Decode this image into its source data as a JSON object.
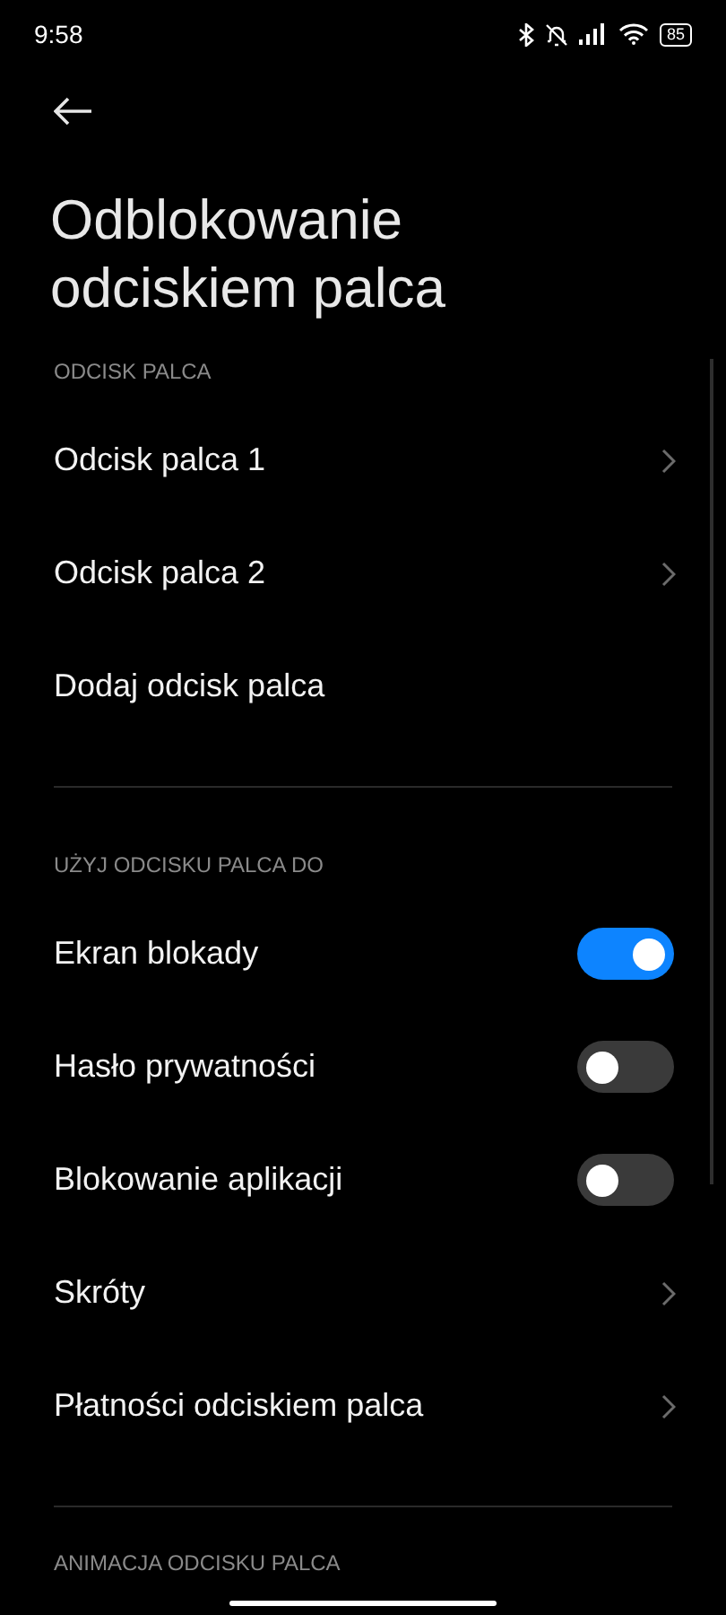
{
  "status_bar": {
    "time": "9:58",
    "battery": "85"
  },
  "title": "Odblokowanie odciskiem palca",
  "sections": [
    {
      "header": "ODCISK PALCA",
      "items": [
        {
          "kind": "link",
          "label": "Odcisk palca 1"
        },
        {
          "kind": "link",
          "label": "Odcisk palca 2"
        },
        {
          "kind": "action",
          "label": "Dodaj odcisk palca"
        }
      ]
    },
    {
      "header": "UŻYJ ODCISKU PALCA DO",
      "items": [
        {
          "kind": "toggle",
          "label": "Ekran blokady",
          "on": true
        },
        {
          "kind": "toggle",
          "label": "Hasło prywatności",
          "on": false
        },
        {
          "kind": "toggle",
          "label": "Blokowanie aplikacji",
          "on": false
        },
        {
          "kind": "link",
          "label": "Skróty"
        },
        {
          "kind": "link",
          "label": "Płatności odciskiem palca"
        }
      ]
    },
    {
      "header": "ANIMACJA ODCISKU PALCA"
    }
  ]
}
